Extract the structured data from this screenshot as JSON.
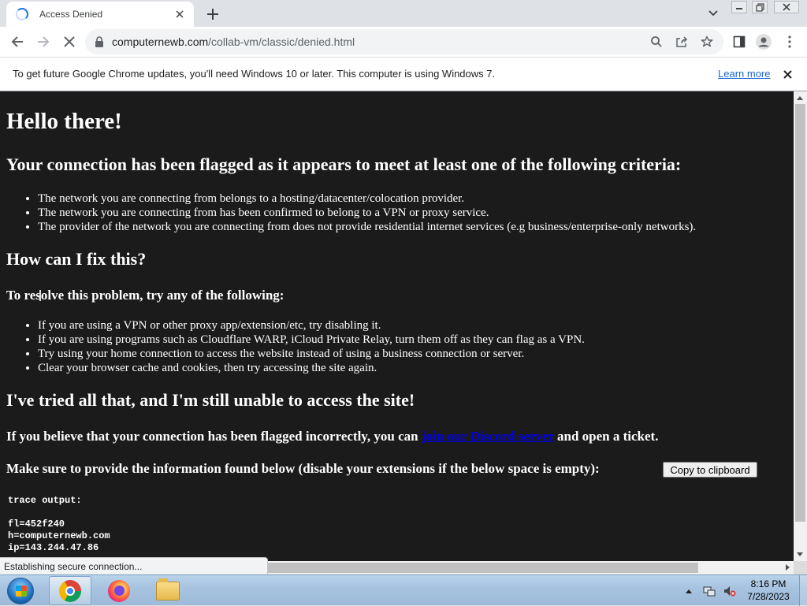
{
  "tab": {
    "title": "Access Denied"
  },
  "toolbar": {
    "url_host": "computernewb.com",
    "url_path": "/collab-vm/classic/denied.html"
  },
  "infobar": {
    "message": "To get future Google Chrome updates, you'll need Windows 10 or later. This computer is using Windows 7.",
    "learn_more": "Learn more"
  },
  "page": {
    "h1": "Hello there!",
    "h2_flagged": "Your connection has been flagged as it appears to meet at least one of the following criteria:",
    "criteria": [
      "The network you are connecting from belongs to a hosting/datacenter/colocation provider.",
      "The network you are connecting from has been confirmed to belong to a VPN or proxy service.",
      "The provider of the network you are connecting from does not provide residential internet services (e.g business/enterprise-only networks)."
    ],
    "h2_fix": "How can I fix this?",
    "h3_resolve": "To resolve this problem, try any of the following:",
    "fixes": [
      "If you are using a VPN or other proxy app/extension/etc, try disabling it.",
      "If you are using programs such as Cloudflare WARP, iCloud Private Relay, turn them off as they can flag as a VPN.",
      "Try using your home connection to access the website instead of using a business connection or server.",
      "Clear your browser cache and cookies, then try accessing the site again."
    ],
    "h2_tried": "I've tried all that, and I'm still unable to access the site!",
    "incorrect_prefix": "If you believe that your connection has been flagged incorrectly, you can ",
    "discord_link": "join our Discord server",
    "incorrect_suffix": " and open a ticket.",
    "provide_info": "Make sure to provide the information found below (disable your extensions if the below space is empty):",
    "copy_button": "Copy to clipboard",
    "trace_label": "trace output:",
    "trace_lines": [
      "fl=452f240",
      "h=computernewb.com",
      "ip=143.244.47.86"
    ]
  },
  "status": {
    "text": "Establishing secure connection..."
  },
  "taskbar": {
    "time": "8:16 PM",
    "date": "7/28/2023"
  }
}
